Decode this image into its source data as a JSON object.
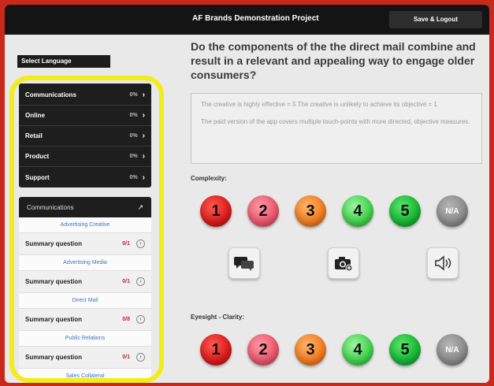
{
  "header": {
    "title": "AF Brands Demonstration Project",
    "logout_label": "Save & Logout"
  },
  "sidebar": {
    "language_label": "Select Language",
    "categories": [
      {
        "name": "Communications",
        "pct": "0%"
      },
      {
        "name": "Online",
        "pct": "0%"
      },
      {
        "name": "Retail",
        "pct": "0%"
      },
      {
        "name": "Product",
        "pct": "0%"
      },
      {
        "name": "Support",
        "pct": "0%"
      }
    ],
    "sub_header": "Communications",
    "sections": [
      {
        "title": "Advertising Creative",
        "summary": "Summary question",
        "score": "0/1"
      },
      {
        "title": "Advertising Media",
        "summary": "Summary question",
        "score": "0/1"
      },
      {
        "title": "Direct Mail",
        "summary": "Summary question",
        "score": "0/8"
      },
      {
        "title": "Public Relations",
        "summary": "Summary question",
        "score": "0/1"
      },
      {
        "title": "Sales Collateral",
        "summary": "",
        "score": ""
      }
    ]
  },
  "main": {
    "question": "Do the components of the the direct mail combine and result in a relevant and appealing way to engage older consumers?",
    "note_line1": "The creative is highly effective = 5 The creative is unlikely to achieve its objective = 1",
    "note_line2": "The paid version of the app covers multiple touch-points with more directed, objective measures.",
    "rating_group_1": {
      "label": "Complexity:",
      "buttons": [
        "1",
        "2",
        "3",
        "4",
        "5",
        "N/A"
      ]
    },
    "rating_group_2": {
      "label": "Eyesight - Clarity:",
      "buttons": [
        "1",
        "2",
        "3",
        "4",
        "5",
        "N/A"
      ]
    },
    "tools": [
      "comments-icon",
      "camera-icon",
      "speaker-icon"
    ]
  },
  "colors": {
    "rating_1": "#d91a1a",
    "rating_2": "#e8566a",
    "rating_3": "#f07a1e",
    "rating_4": "#3fd14a",
    "rating_5": "#15b534",
    "rating_na": "#8a8a8a",
    "highlight": "#f2ec1c"
  }
}
